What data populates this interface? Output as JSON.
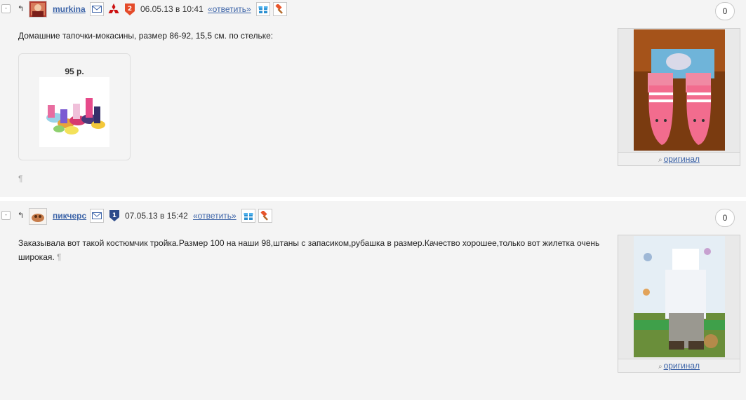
{
  "comments": [
    {
      "username": "murkina",
      "date": "06.05.13 в 10:41",
      "reply_label": "«ответить»",
      "rank_badge": "2",
      "text": "Домашние тапочки-мокасины, размер 86-92, 15,5 см. по стельке:",
      "price": "95 р.",
      "pilcrow": "¶",
      "counter": "0",
      "original_link": "оригинал",
      "icons": [
        "collapse-icon",
        "reply-up-arrow-icon",
        "avatar",
        "mail-icon",
        "mitsubishi-logo-icon",
        "rank-badge-icon",
        "gift-icon",
        "hammer-icon",
        "magnifier-icon"
      ]
    },
    {
      "username": "пикчерс",
      "date": "07.05.13 в 15:42",
      "reply_label": "«ответить»",
      "rank_badge": "1",
      "text_line1": "Заказывала вот такой костюмчик тройка.Размер 100 на наши 98,штаны с запасиком,рубашка в размер.Качество хорошее,только вот жилетка очень",
      "text_line2": "широкая.",
      "pilcrow": "¶",
      "counter": "0",
      "original_link": "оригинал",
      "icons": [
        "collapse-icon",
        "reply-up-arrow-icon",
        "avatar",
        "mail-icon",
        "shield-badge-icon",
        "gift-icon",
        "hammer-icon",
        "magnifier-icon"
      ]
    }
  ],
  "collapse_symbol": "-",
  "up_arrow_symbol": "↰",
  "colors": {
    "link": "#3d64a8",
    "background": "#f4f4f4",
    "gift": "#2a8fd0",
    "hammer": "#e8542a"
  }
}
